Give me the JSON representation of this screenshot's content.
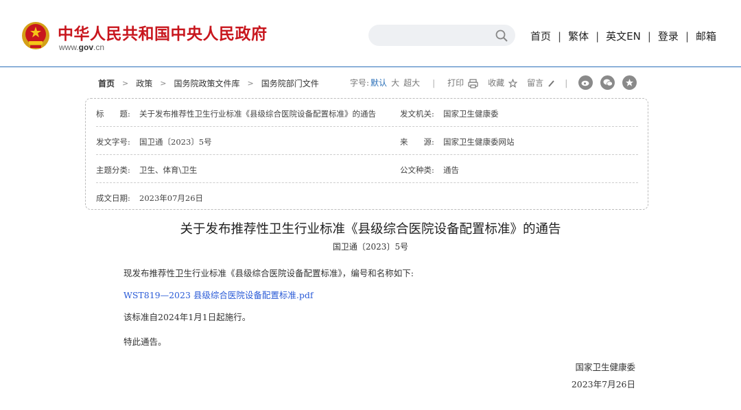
{
  "header": {
    "site_name": "中华人民共和国中央人民政府",
    "site_url_prefix": "www.",
    "site_url_domain": "gov",
    "site_url_suffix": ".cn",
    "search": {
      "placeholder": "",
      "icon": "search-icon"
    },
    "nav": [
      "首页",
      "繁体",
      "英文EN",
      "登录",
      "邮箱"
    ]
  },
  "breadcrumb": [
    "首页",
    "政策",
    "国务院政策文件库",
    "国务院部门文件"
  ],
  "toolbar": {
    "font_label": "字号:",
    "font_default": "默认",
    "font_large": "大",
    "font_xlarge": "超大",
    "print": "打印",
    "favorite": "收藏",
    "comment": "留言"
  },
  "info": {
    "title_label": "标　　题:",
    "title_value": "关于发布推荐性卫生行业标准《县级综合医院设备配置标准》的通告",
    "issuer_label": "发文机关:",
    "issuer_value": "国家卫生健康委",
    "docno_label": "发文字号:",
    "docno_value": "国卫通〔2023〕5号",
    "source_label": "来　　源:",
    "source_value": "国家卫生健康委网站",
    "topic_label": "主题分类:",
    "topic_value": "卫生、体育\\卫生",
    "type_label": "公文种类:",
    "type_value": "通告",
    "date_label": "成文日期:",
    "date_value": "2023年07月26日"
  },
  "article": {
    "title": "关于发布推荐性卫生行业标准《县级综合医院设备配置标准》的通告",
    "docno": "国卫通〔2023〕5号",
    "p1": "现发布推荐性卫生行业标准《县级综合医院设备配置标准》，编号和名称如下:",
    "link": "WST819—2023 县级综合医院设备配置标准.pdf",
    "p2": "该标准自2024年1月1日起施行。",
    "p3": "特此通告。",
    "signer": "国家卫生健康委",
    "sign_date": "2023年7月26日"
  },
  "colors": {
    "brand_red": "#c8161d",
    "link_blue": "#2a5bd7",
    "accent_blue": "#2a6fb8"
  }
}
